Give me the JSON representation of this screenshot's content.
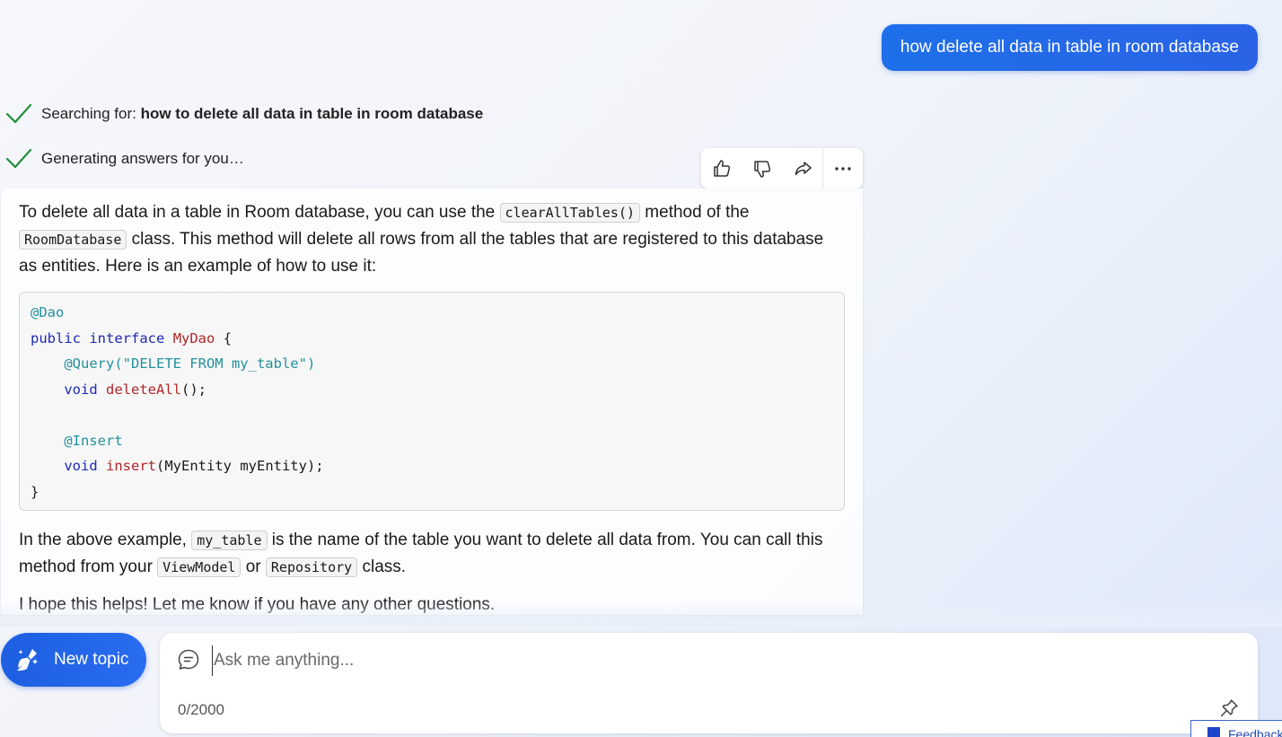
{
  "conversation": {
    "user_message": "how delete all data in table in room database",
    "status": {
      "searching_prefix": "Searching for: ",
      "searching_query": "how to delete all data in table in room database",
      "generating": "Generating answers for you…"
    },
    "answer": {
      "p1_a": "To delete all data in a table in Room database, you can use the ",
      "p1_code1": "clearAllTables()",
      "p1_b": " method of the ",
      "p1_code2": "RoomDatabase",
      "p1_c": " class. This method will delete all rows from all the tables that are registered to this database as entities. Here is an example of how to use it:",
      "code": {
        "l1": "@Dao",
        "l2_kw1": "public",
        "l2_kw2": "interface",
        "l2_name": "MyDao",
        "l2_rest": " {",
        "l3_ann": "@Query(",
        "l3_str": "\"DELETE FROM my_table\"",
        "l3_end": ")",
        "l4_kw": "void",
        "l4_name": "deleteAll",
        "l4_rest": "();",
        "l6_ann": "@Insert",
        "l7_kw": "void",
        "l7_name": "insert",
        "l7_rest": "(MyEntity myEntity);",
        "l8": "}"
      },
      "p2_a": "In the above example, ",
      "p2_code1": "my_table",
      "p2_b": " is the name of the table you want to delete all data from. You can call this method from your ",
      "p2_code2": "ViewModel",
      "p2_c": " or ",
      "p2_code3": "Repository",
      "p2_d": " class.",
      "p3": "I hope this helps! Let me know if you have any other questions."
    }
  },
  "actions": {
    "icons": [
      "thumbs-up-icon",
      "thumbs-down-icon",
      "share-icon",
      "more-icon"
    ]
  },
  "composer": {
    "new_topic_label": "New topic",
    "placeholder": "Ask me anything...",
    "char_count": "0/2000"
  },
  "feedback_tab": {
    "label": "Feedback"
  },
  "colors": {
    "accent": "#1e6fea",
    "check": "#1f8f3a"
  }
}
